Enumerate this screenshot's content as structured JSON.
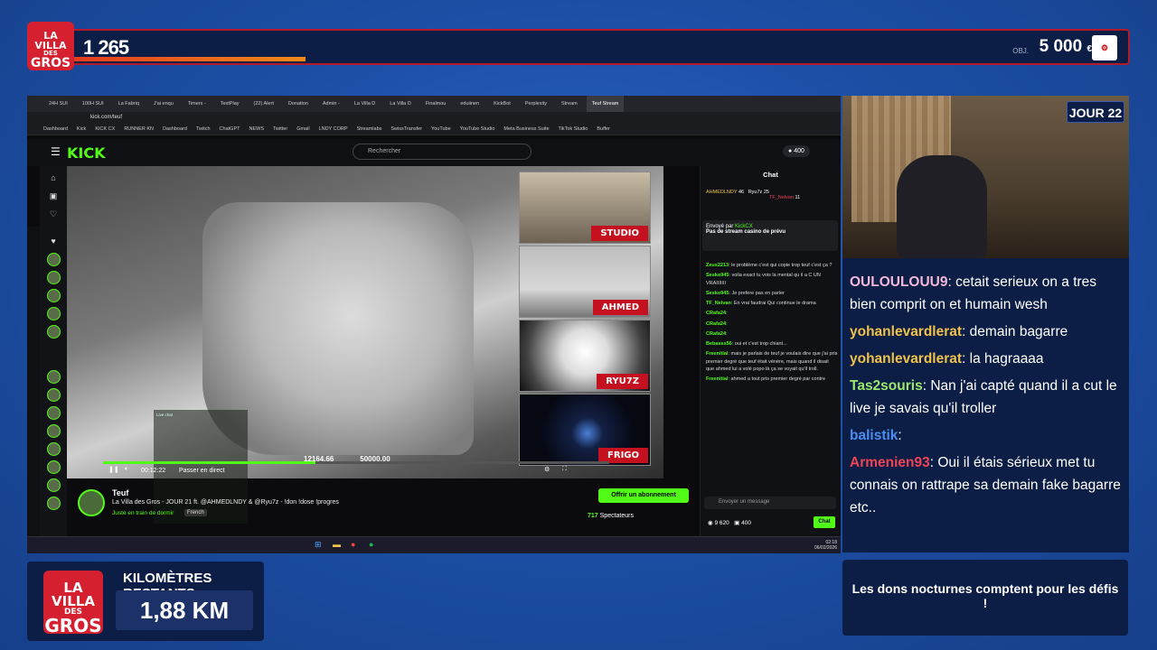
{
  "overlay": {
    "logo_line1": "LA VILLA",
    "logo_line2": "DES",
    "logo_line3": "GROS",
    "donation_count": "1 265",
    "goal_label": "OBJ.",
    "goal_value": "5 000",
    "goal_currency": "€",
    "day_badge": "JOUR 22",
    "km_label": "KILOMÈTRES RESTANTS :",
    "km_value": "1,88 KM",
    "info_text": "Les dons nocturnes comptent pour les défis !",
    "chat": [
      {
        "user": "OULOULOUU9",
        "text": ": cetait serieux on a tres bien comprit on et humain wesh",
        "color": "pink"
      },
      {
        "user": "yohanlevardlerat",
        "text": ": demain bagarre",
        "color": "gold"
      },
      {
        "user": "yohanlevardlerat",
        "text": ": la hagraaaa",
        "color": "gold"
      },
      {
        "user": "Tas2souris",
        "text": ": Nan j'ai capté quand il a cut le live je savais qu'il troller",
        "color": "green"
      },
      {
        "user": "balistik",
        "text": ":",
        "color": "blue"
      },
      {
        "user": "Armenien93",
        "text": ": Oui il étais sérieux met tu connais on rattrape sa demain fake bagarre etc..",
        "color": "red"
      }
    ],
    "colors": {
      "overlay_bg": "#0d1e46",
      "accent_red": "#d4202f",
      "kick_green": "#53fc18"
    }
  },
  "browser": {
    "tabs": [
      "24H SUI",
      "100H SUI",
      "La Fabriq",
      "J'ai enqu",
      "Timers -",
      "TextPlay",
      "(22) Alert",
      "Donation",
      "Admin -",
      "La Villa D",
      "La Villa D",
      "Finalmou",
      "eduiinen",
      "KickBot",
      "Perplexity",
      "Stream",
      "Teuf Stream"
    ],
    "url": "kick.com/teuf",
    "bookmarks": [
      "Dashboard",
      "Kick",
      "KICK CX",
      "RUNNER KN",
      "Dashboard",
      "Twitch",
      "ChatGPT",
      "NEWS",
      "Twitter",
      "Gmail",
      "LNDY CORP",
      "Streamlabs",
      "SwissTransfer",
      "YouTube",
      "YouTube Studio",
      "Meta Business Suite",
      "TikTok Studio",
      "Buffer"
    ]
  },
  "kick": {
    "search_placeholder": "Rechercher",
    "coins": "400",
    "cams": [
      "STUDIO",
      "AHMED",
      "RYU7Z",
      "FRIGO"
    ],
    "player": {
      "time": "00:12:22",
      "go_live": "Passer en direct",
      "score_left": "12164.66",
      "score_right": "50000.00"
    },
    "overlay_chat_title": "Live chat",
    "stream": {
      "name": "Teuf",
      "title": "La Villa des Gros - JOUR 21 ft. @AHMEDLNDY & @Ryu7z - !don !dose !progres",
      "category": "Juste en train de dormir",
      "language": "French",
      "subscribe": "Offrir un abonnement",
      "viewers": "717",
      "viewers_label": "Spectateurs"
    },
    "chat": {
      "title": "Chat",
      "top1": "AHMEDLNDY",
      "top1_count": "46",
      "top2": "Ryu7z",
      "top2_count": "25",
      "top3": "TF_Nelvan",
      "top3_count": "11",
      "pin_from": "Envoyé par",
      "pin_user": "KickCX",
      "pin_text": "Pas de stream casino de prévu",
      "messages": [
        {
          "user": "Zeus2213",
          "text": ": le problème c'est qui copie trop teuf c'est ça ?"
        },
        {
          "user": "Sesko945",
          "text": ": voila exact tu vois la mental qu il a C UN VRAIIIIIII"
        },
        {
          "user": "Sesko945",
          "text": ": Je prefere pas en parler"
        },
        {
          "user": "TF_Nelvan",
          "text": ": En vrai faudrai Qui continue le drama"
        },
        {
          "user": "CRafa24",
          "text": ":"
        },
        {
          "user": "CRafa24",
          "text": ":"
        },
        {
          "user": "CRafa24",
          "text": ":"
        },
        {
          "user": "Bebasss56",
          "text": ": oui et c'est trop chiant..."
        },
        {
          "user": "Freenitial",
          "text": ": mais je parlais de teuf je voulais dire que j'ai pris premier degré que teuf était vénère, mais quand il disait que ahmed lui a volé popo là ça se voyait qu'il troll."
        },
        {
          "user": "Freenitial",
          "text": ": ahmed a tout pris premier degré par contre"
        }
      ],
      "input_placeholder": "Envoyer un message",
      "points": "9 620",
      "coins": "400",
      "send": "Chat"
    },
    "clock_time": "02:18",
    "clock_date": "06/02/2026"
  }
}
